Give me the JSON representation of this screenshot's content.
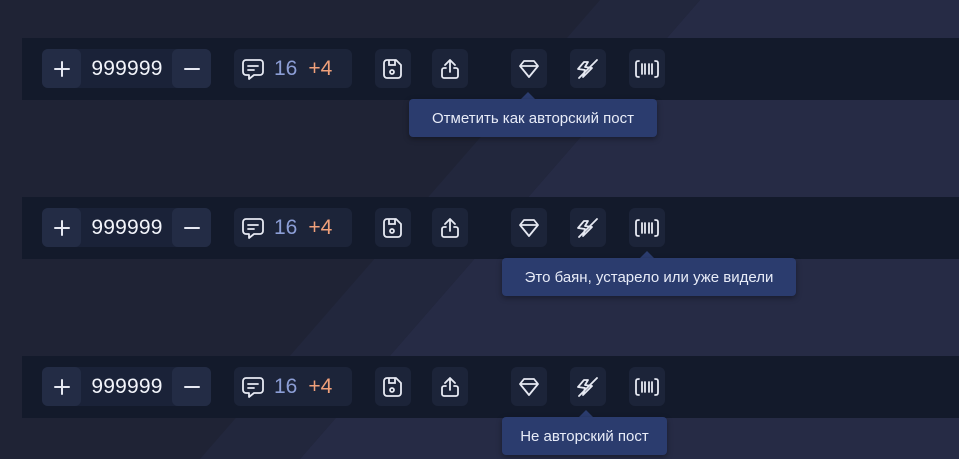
{
  "bars": [
    {
      "vote": {
        "score": "999999",
        "plus_icon": "plus-icon",
        "minus_icon": "minus-icon"
      },
      "comments": {
        "icon": "comment-icon",
        "count": "16",
        "new": "+4"
      },
      "actions": [
        "save-icon",
        "share-icon",
        "gem-icon",
        "lightning-strike-icon",
        "barcode-icon"
      ],
      "tooltip": {
        "text": "Отметить как авторский пост",
        "target": "gem-icon"
      }
    },
    {
      "vote": {
        "score": "999999",
        "plus_icon": "plus-icon",
        "minus_icon": "minus-icon"
      },
      "comments": {
        "icon": "comment-icon",
        "count": "16",
        "new": "+4"
      },
      "actions": [
        "save-icon",
        "share-icon",
        "gem-icon",
        "lightning-strike-icon",
        "barcode-icon"
      ],
      "tooltip": {
        "text": "Это баян, устарело или уже видели",
        "target": "barcode-icon"
      }
    },
    {
      "vote": {
        "score": "999999",
        "plus_icon": "plus-icon",
        "minus_icon": "minus-icon"
      },
      "comments": {
        "icon": "comment-icon",
        "count": "16",
        "new": "+4"
      },
      "actions": [
        "save-icon",
        "share-icon",
        "gem-icon",
        "lightning-strike-icon",
        "barcode-icon"
      ],
      "tooltip": {
        "text": "Не авторский пост",
        "target": "lightning-strike-icon"
      }
    }
  ],
  "colors": {
    "background": "#1f2335",
    "bar": "#131a2b",
    "button": "#1c2439",
    "count": "#8c9ed6",
    "new_count": "#f0a07a",
    "tooltip": "#2b3c6e"
  }
}
